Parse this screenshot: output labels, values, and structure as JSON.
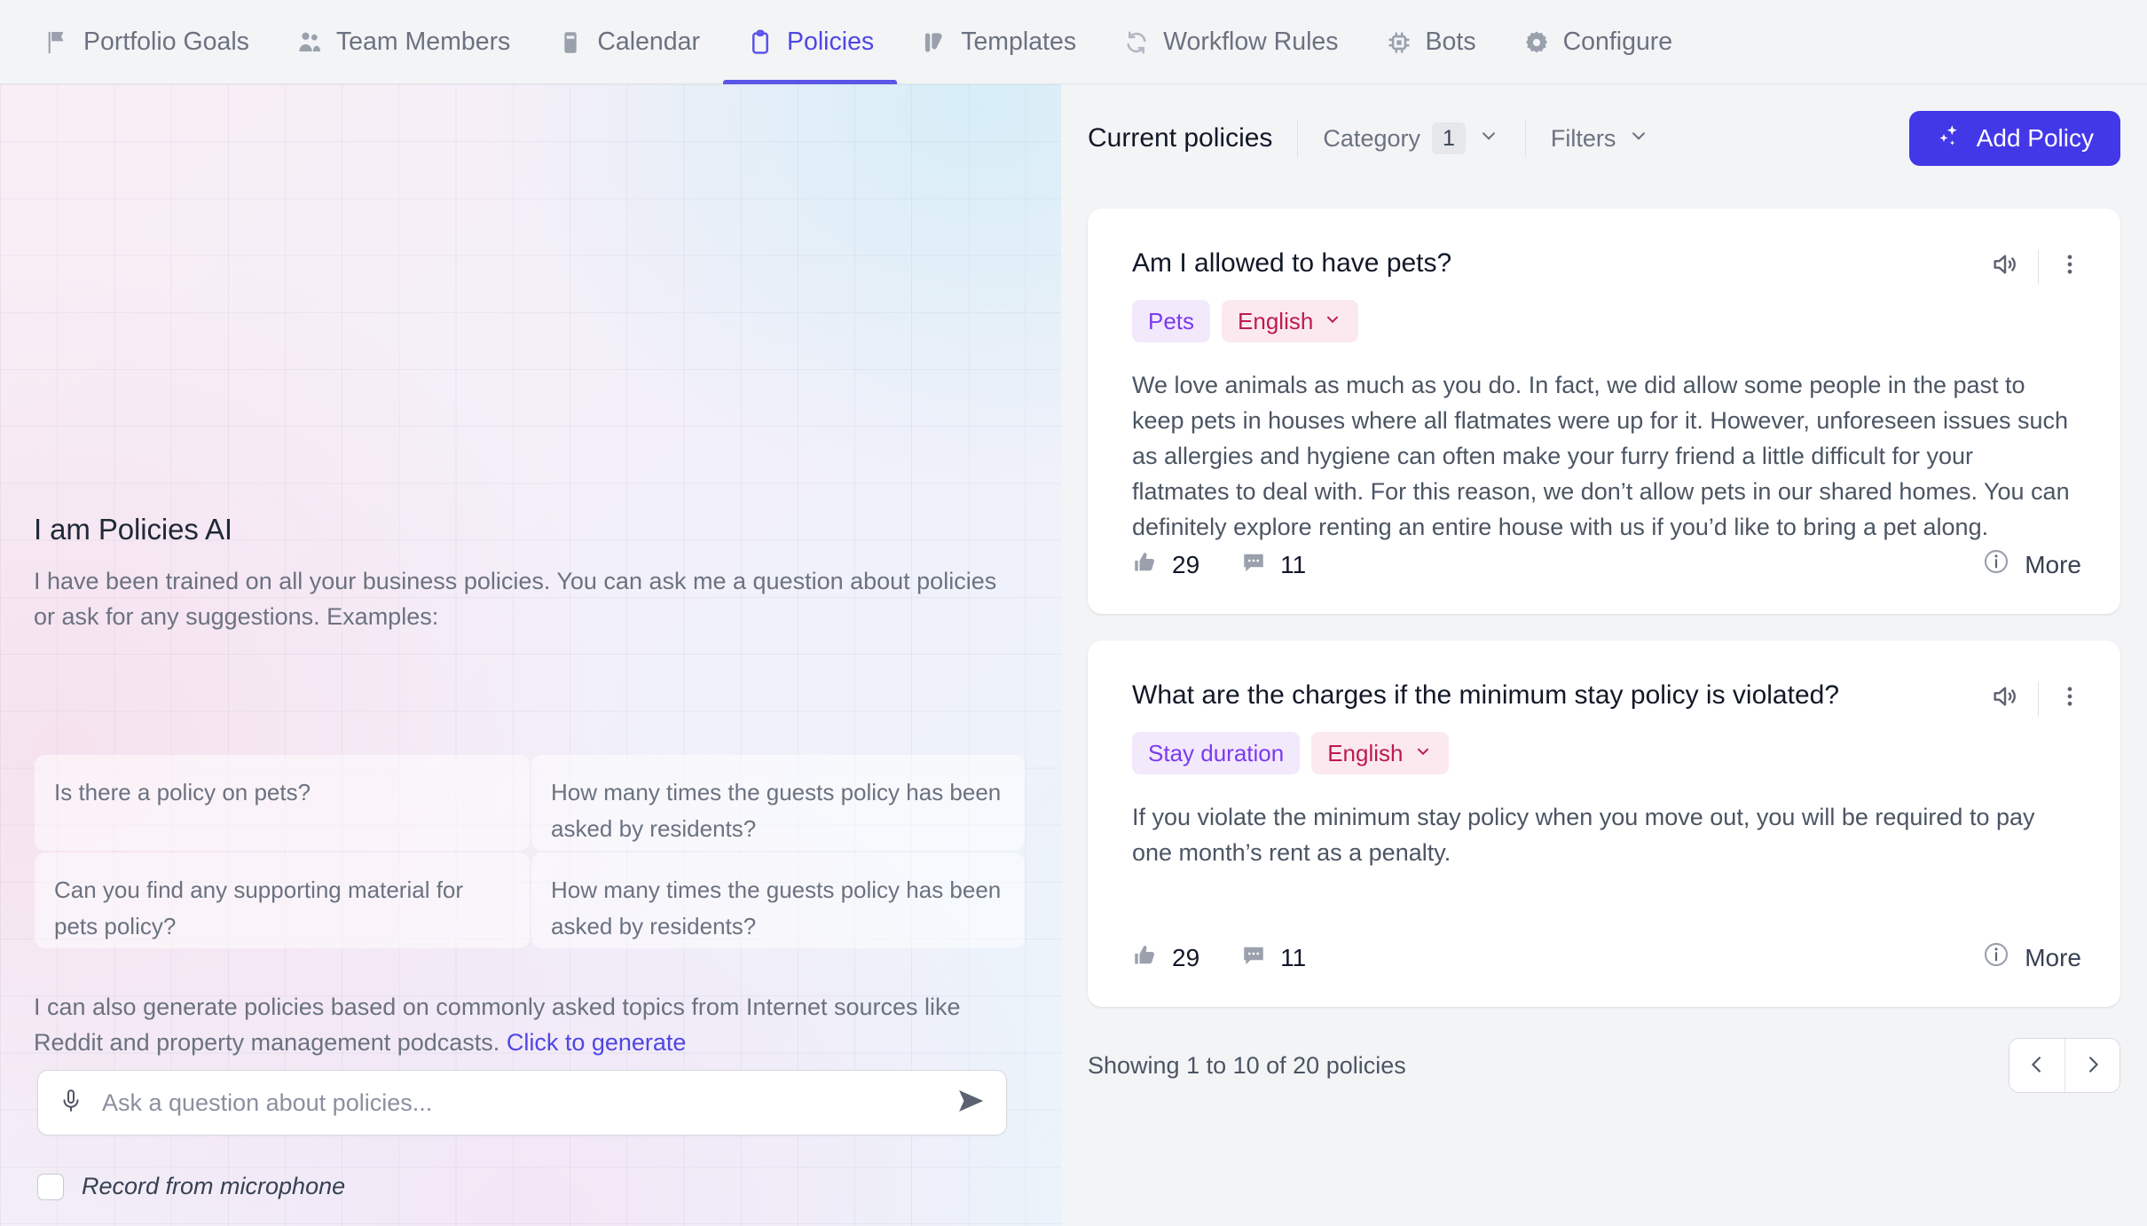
{
  "nav": {
    "items": [
      {
        "label": "Portfolio Goals",
        "icon": "flag-icon",
        "active": false
      },
      {
        "label": "Team Members",
        "icon": "people-icon",
        "active": false
      },
      {
        "label": "Calendar",
        "icon": "calendar-icon",
        "active": false
      },
      {
        "label": "Policies",
        "icon": "clipboard-icon",
        "active": true
      },
      {
        "label": "Templates",
        "icon": "templates-icon",
        "active": false
      },
      {
        "label": "Workflow Rules",
        "icon": "refresh-icon",
        "active": false
      },
      {
        "label": "Bots",
        "icon": "chip-icon",
        "active": false
      },
      {
        "label": "Configure",
        "icon": "gear-icon",
        "active": false
      }
    ]
  },
  "assistant": {
    "title": "I am Policies AI",
    "description": "I have been trained on all your business policies. You can ask me a question about policies or ask for any suggestions. Examples:",
    "suggestions": [
      "Is there a policy on pets?",
      "How many times the guests policy has been asked by residents?",
      "Can you find any supporting material for pets policy?",
      "How many times the guests policy has been asked by residents?"
    ],
    "generate_text": "I can also generate policies based on commonly asked topics from Internet sources like Reddit and property management podcasts. ",
    "generate_link": "Click to generate",
    "input_placeholder": "Ask a question about policies...",
    "input_value": "",
    "mic_icon": "microphone-icon",
    "send_icon": "send-icon",
    "record_label": "Record from microphone",
    "record_checked": false
  },
  "policies_panel": {
    "title": "Current policies",
    "category_label": "Category",
    "category_count": "1",
    "filters_label": "Filters",
    "add_policy_label": "Add Policy",
    "add_policy_icon": "sparkles-icon",
    "accent_color": "#4338e8",
    "cards": [
      {
        "question": "Am I allowed to have pets?",
        "category": "Pets",
        "language": "English",
        "body": "We love animals as much as you do. In fact, we did allow some people in the past to keep pets in houses where all flatmates were up for it. However, unforeseen issues such as allergies and hygiene can often make your furry friend a little difficult for your flatmates to deal with. For this reason, we don’t allow pets in our shared homes. You can definitely explore renting an entire house with us if you’d like to bring a pet along.",
        "likes": "29",
        "comments": "11",
        "more_label": "More",
        "speaker_icon": "speaker-icon",
        "menu_icon": "kebab-menu-icon"
      },
      {
        "question": "What are the charges if the minimum stay policy is violated?",
        "category": "Stay duration",
        "language": "English",
        "body": "If you violate the minimum stay policy when you move out, you will be required to pay one month’s rent as a penalty.",
        "likes": "29",
        "comments": "11",
        "more_label": "More",
        "speaker_icon": "speaker-icon",
        "menu_icon": "kebab-menu-icon"
      }
    ],
    "showing_text": "Showing 1 to 10 of 20 policies",
    "prev_icon": "chevron-left-icon",
    "next_icon": "chevron-right-icon"
  }
}
